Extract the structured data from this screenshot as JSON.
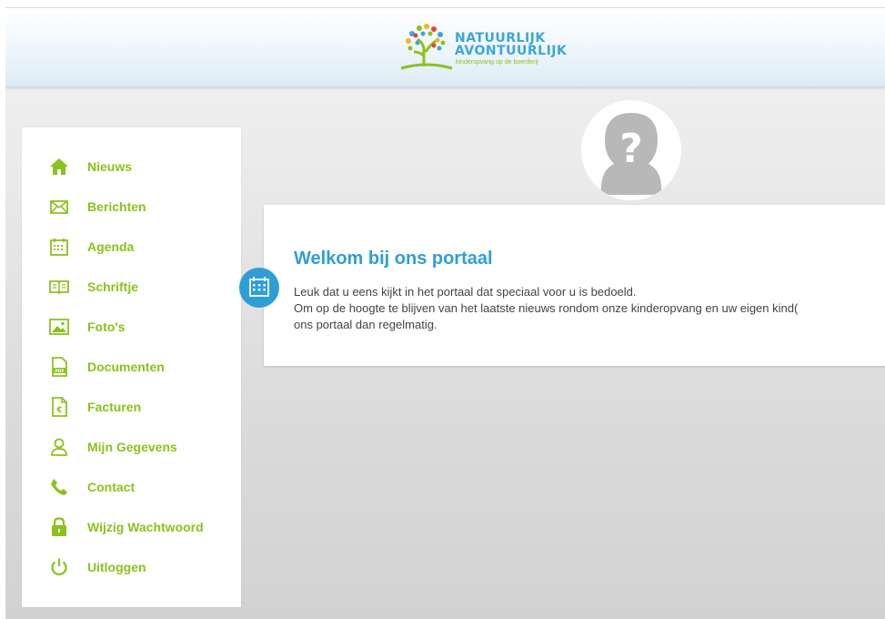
{
  "header": {
    "logo": {
      "line1": "NATUURLIJK",
      "line2": "AVONTUURLIJK",
      "tagline": "kinderopvang op de boerderij"
    }
  },
  "sidebar": {
    "items": [
      {
        "label": "Nieuws",
        "icon": "home-icon"
      },
      {
        "label": "Berichten",
        "icon": "envelope-icon"
      },
      {
        "label": "Agenda",
        "icon": "calendar-icon"
      },
      {
        "label": "Schriftje",
        "icon": "book-icon"
      },
      {
        "label": "Foto's",
        "icon": "photo-icon"
      },
      {
        "label": "Documenten",
        "icon": "pdf-document-icon"
      },
      {
        "label": "Facturen",
        "icon": "invoice-euro-icon"
      },
      {
        "label": "Mijn Gegevens",
        "icon": "user-icon"
      },
      {
        "label": "Contact",
        "icon": "phone-icon"
      },
      {
        "label": "Wijzig Wachtwoord",
        "icon": "lock-icon"
      },
      {
        "label": "Uitloggen",
        "icon": "power-icon"
      }
    ]
  },
  "main": {
    "avatar_icon": "unknown-person-icon",
    "welcome": {
      "title": "Welkom bij ons portaal",
      "badge_icon": "calendar-icon",
      "lines": [
        "Leuk dat u eens kijkt in het portaal dat speciaal voor u is bedoeld.",
        "Om op de hoogte te blijven van het laatste nieuws rondom onze kinderopvang en uw eigen kind(",
        "ons portaal dan regelmatig."
      ]
    }
  },
  "colors": {
    "accent_green": "#8bc21d",
    "accent_blue": "#2e9fd6"
  }
}
